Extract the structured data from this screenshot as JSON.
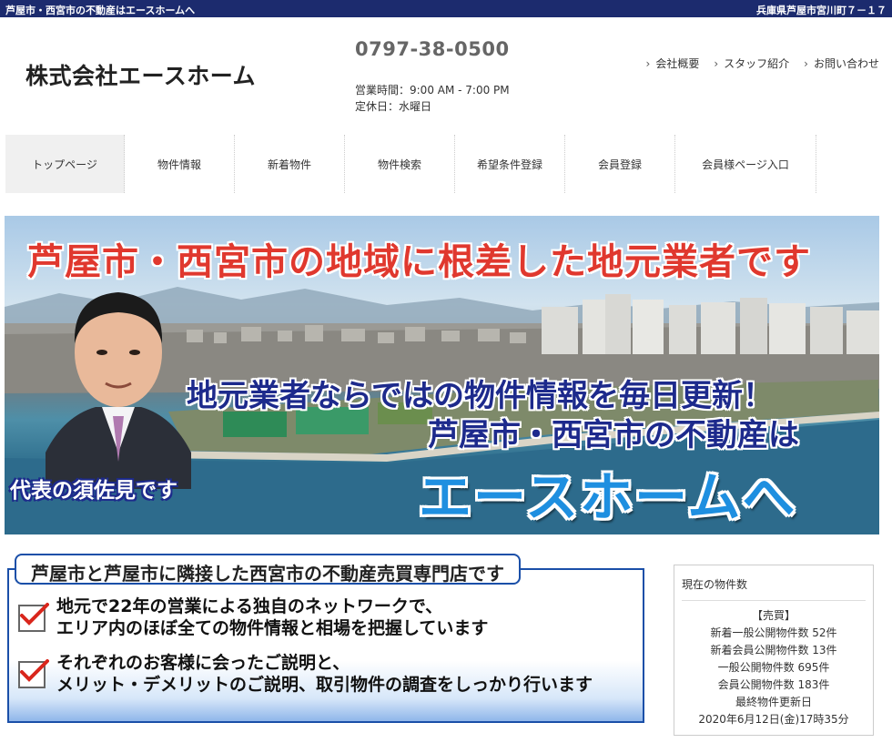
{
  "topbar": {
    "left_text": "芦屋市・西宮市の不動産はエースホームへ",
    "right_text": "兵庫県芦屋市宮川町７－１７"
  },
  "header": {
    "company_name": "株式会社エースホーム",
    "phone": "0797-38-0500",
    "hours": "営業時間：9:00 AM - 7:00 PM",
    "closed": "定休日：水曜日",
    "links": [
      "会社概要",
      "スタッフ紹介",
      "お問い合わせ"
    ]
  },
  "nav": {
    "items": [
      "トップページ",
      "物件情報",
      "新着物件",
      "物件検索",
      "希望条件登録",
      "会員登録",
      "会員様ページ入口"
    ]
  },
  "hero": {
    "headline": "芦屋市・西宮市の地域に根差した地元業者です",
    "line1": "地元業者ならではの物件情報を毎日更新！",
    "line2": "芦屋市・西宮市の不動産は",
    "line3": "エースホームへ",
    "caption": "代表の須佐見です"
  },
  "feature": {
    "title": "芦屋市と芦屋市に隣接した西宮市の不動産売買専門店です",
    "points": [
      [
        "地元で22年の営業による独自のネットワークで、",
        "エリア内のほぼ全ての物件情報と相場を把握しています"
      ],
      [
        "それぞれのお客様に会ったご説明と、",
        "メリット・デメリットのご説明、取引物件の調査をしっかり行います"
      ]
    ]
  },
  "sidebox": {
    "title": "現在の物件数",
    "lines": [
      "【売買】",
      "新着一般公開物件数 52件",
      "新着会員公開物件数 13件",
      "一般公開物件数 695件",
      "会員公開物件数 183件",
      "最終物件更新日",
      "2020年6月12日(金)17時35分"
    ]
  },
  "colors": {
    "topbar": "#1c2b6e",
    "headline_red": "#e0382e",
    "navy_text": "#1d2a8c",
    "brand_blue": "#1e8fe0",
    "check_red": "#d9261c"
  }
}
